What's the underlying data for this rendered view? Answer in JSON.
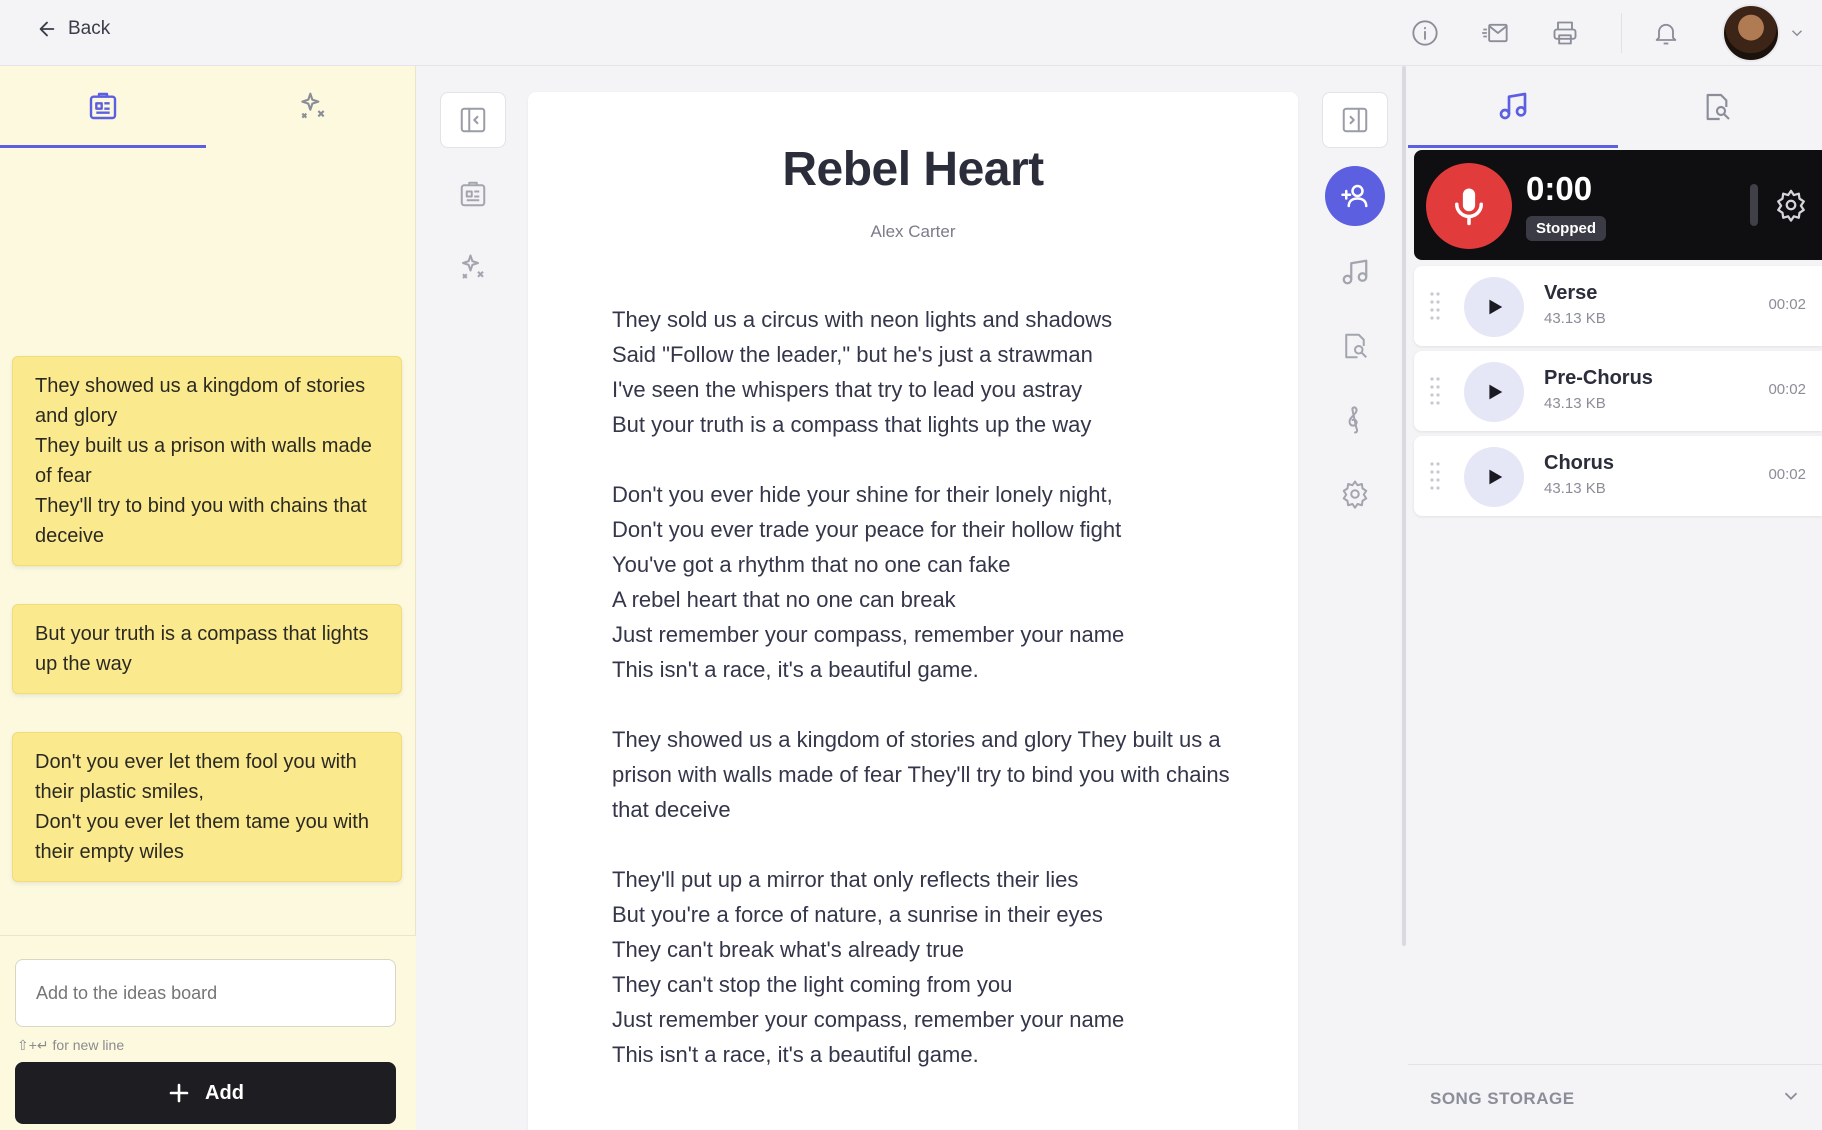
{
  "topbar": {
    "back_label": "Back"
  },
  "ideas": {
    "notes": [
      "They showed us a kingdom of stories and glory\nThey built us a prison with walls made of fear\nThey'll try to bind you with chains that deceive",
      "But your truth is a compass that lights up the way",
      "Don't you ever let them fool you with their plastic smiles,\nDon't you ever let them tame you with their empty wiles"
    ],
    "input_placeholder": "Add to the ideas board",
    "hint": "⇧+↵ for new line",
    "add_label": "Add"
  },
  "song": {
    "title": "Rebel Heart",
    "author": "Alex Carter",
    "stanzas": [
      [
        "They sold us a circus with neon lights and shadows",
        "Said \"Follow the leader,\" but he's just a strawman",
        "I've seen the whispers that try to lead you astray",
        "But your truth is a compass that lights up the way"
      ],
      [
        "Don't you ever hide your shine for their lonely night,",
        "Don't you ever trade your peace for their hollow fight",
        "You've got a rhythm that no one can fake",
        "A rebel heart that no one can break",
        "Just remember your compass, remember your name",
        "This isn't a race, it's a beautiful game."
      ],
      [
        "They showed us a kingdom of stories and glory They built us a prison with walls made of fear They'll try to bind you with chains that deceive"
      ],
      [
        "They'll put up a mirror that only reflects their lies",
        "But you're a force of nature, a sunrise in their eyes",
        "They can't break what's already true",
        "They can't stop the light coming from you",
        "Just remember your compass, remember your name",
        "This isn't a race, it's a beautiful game."
      ]
    ]
  },
  "recorder": {
    "time": "0:00",
    "status": "Stopped"
  },
  "recordings": [
    {
      "name": "Verse",
      "size": "43.13 KB",
      "duration": "00:02"
    },
    {
      "name": "Pre-Chorus",
      "size": "43.13 KB",
      "duration": "00:02"
    },
    {
      "name": "Chorus",
      "size": "43.13 KB",
      "duration": "00:02"
    }
  ],
  "storage": {
    "label": "SONG STORAGE"
  },
  "colors": {
    "accent": "#5b5fe0",
    "record": "#e23b3b",
    "note": "#fbe98e"
  }
}
